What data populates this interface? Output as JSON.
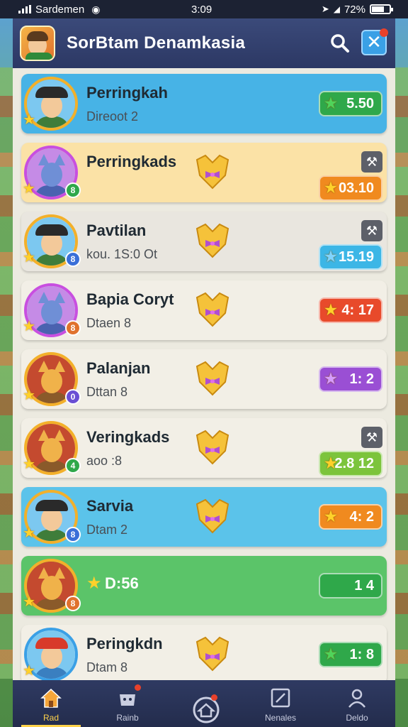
{
  "status_bar": {
    "carrier": "Sardemen",
    "time": "3:09",
    "battery": "72%",
    "battery_level": 0.72
  },
  "header": {
    "title": "SorBtam Denamkasia",
    "icons": [
      "app-avatar-icon",
      "search-icon",
      "close-icon"
    ]
  },
  "leaderboard": [
    {
      "name": "Perringkah",
      "sub": "Direoot 2",
      "score": "5.50",
      "avatar": "hat-boy",
      "level": "",
      "card_color": "#47b3e6",
      "pill_color": "#2fa84a",
      "pill_star": "green",
      "tool": false,
      "trophy": false
    },
    {
      "name": "Perringkads",
      "sub": "",
      "score": "03.10",
      "avatar": "blue-cat",
      "level": "8",
      "card_color": "#fbe2a6",
      "pill_color": "#f08a1f",
      "pill_star": "gold",
      "tool": true,
      "trophy": true
    },
    {
      "name": "Pavtilan",
      "sub": "kou. 1S:0 Ot",
      "score": "15.19",
      "avatar": "hat-boy",
      "level": "8",
      "card_color": "#e9e6df",
      "pill_color": "#3cb6e6",
      "pill_star": "blue",
      "tool": true,
      "trophy": true
    },
    {
      "name": "Bapia Coryt",
      "sub": "Dtaen 8",
      "score": "4: 17",
      "avatar": "blue-cat",
      "level": "8",
      "card_color": "#f2efe6",
      "pill_color": "#e84a2b",
      "pill_star": "gold",
      "tool": false,
      "trophy": true
    },
    {
      "name": "Palanjan",
      "sub": "Dttan 8",
      "score": "1: 2",
      "avatar": "fox",
      "level": "0",
      "card_color": "#f2efe6",
      "pill_color": "#9a4fd4",
      "pill_star": "purple",
      "tool": false,
      "trophy": true
    },
    {
      "name": "Veringkads",
      "sub": "aoo :8",
      "score": "2.8 12",
      "avatar": "fox",
      "level": "4",
      "card_color": "#f2efe6",
      "pill_color": "#7cc43c",
      "pill_star": "gold",
      "tool": true,
      "trophy": true
    },
    {
      "name": "Sarvia",
      "sub": "Dtam 2",
      "score": "4: 2",
      "avatar": "hat-boy",
      "level": "8",
      "card_color": "#5bc3ea",
      "pill_color": "#f08a1f",
      "pill_star": "gold",
      "tool": false,
      "trophy": true
    },
    {
      "name": "",
      "sub": "D:56",
      "score": "1 4",
      "avatar": "fox",
      "level": "8",
      "card_color": "#5bc469",
      "pill_color": "#2fa84a",
      "pill_star": "",
      "tool": false,
      "trophy": false
    },
    {
      "name": "Peringkdn",
      "sub": "Dtam 8",
      "score": "1: 8",
      "avatar": "red-hat",
      "level": "",
      "card_color": "#f2efe6",
      "pill_color": "#2fa84a",
      "pill_star": "green",
      "tool": false,
      "trophy": true
    }
  ],
  "bottom_nav": [
    {
      "label": "Rad",
      "icon": "home-icon",
      "active": true
    },
    {
      "label": "Rainb",
      "icon": "shop-icon",
      "active": false
    },
    {
      "label": "",
      "icon": "house-circle-icon",
      "active": false
    },
    {
      "label": "Nenales",
      "icon": "edit-icon",
      "active": false
    },
    {
      "label": "Deldo",
      "icon": "profile-icon",
      "active": false
    }
  ]
}
